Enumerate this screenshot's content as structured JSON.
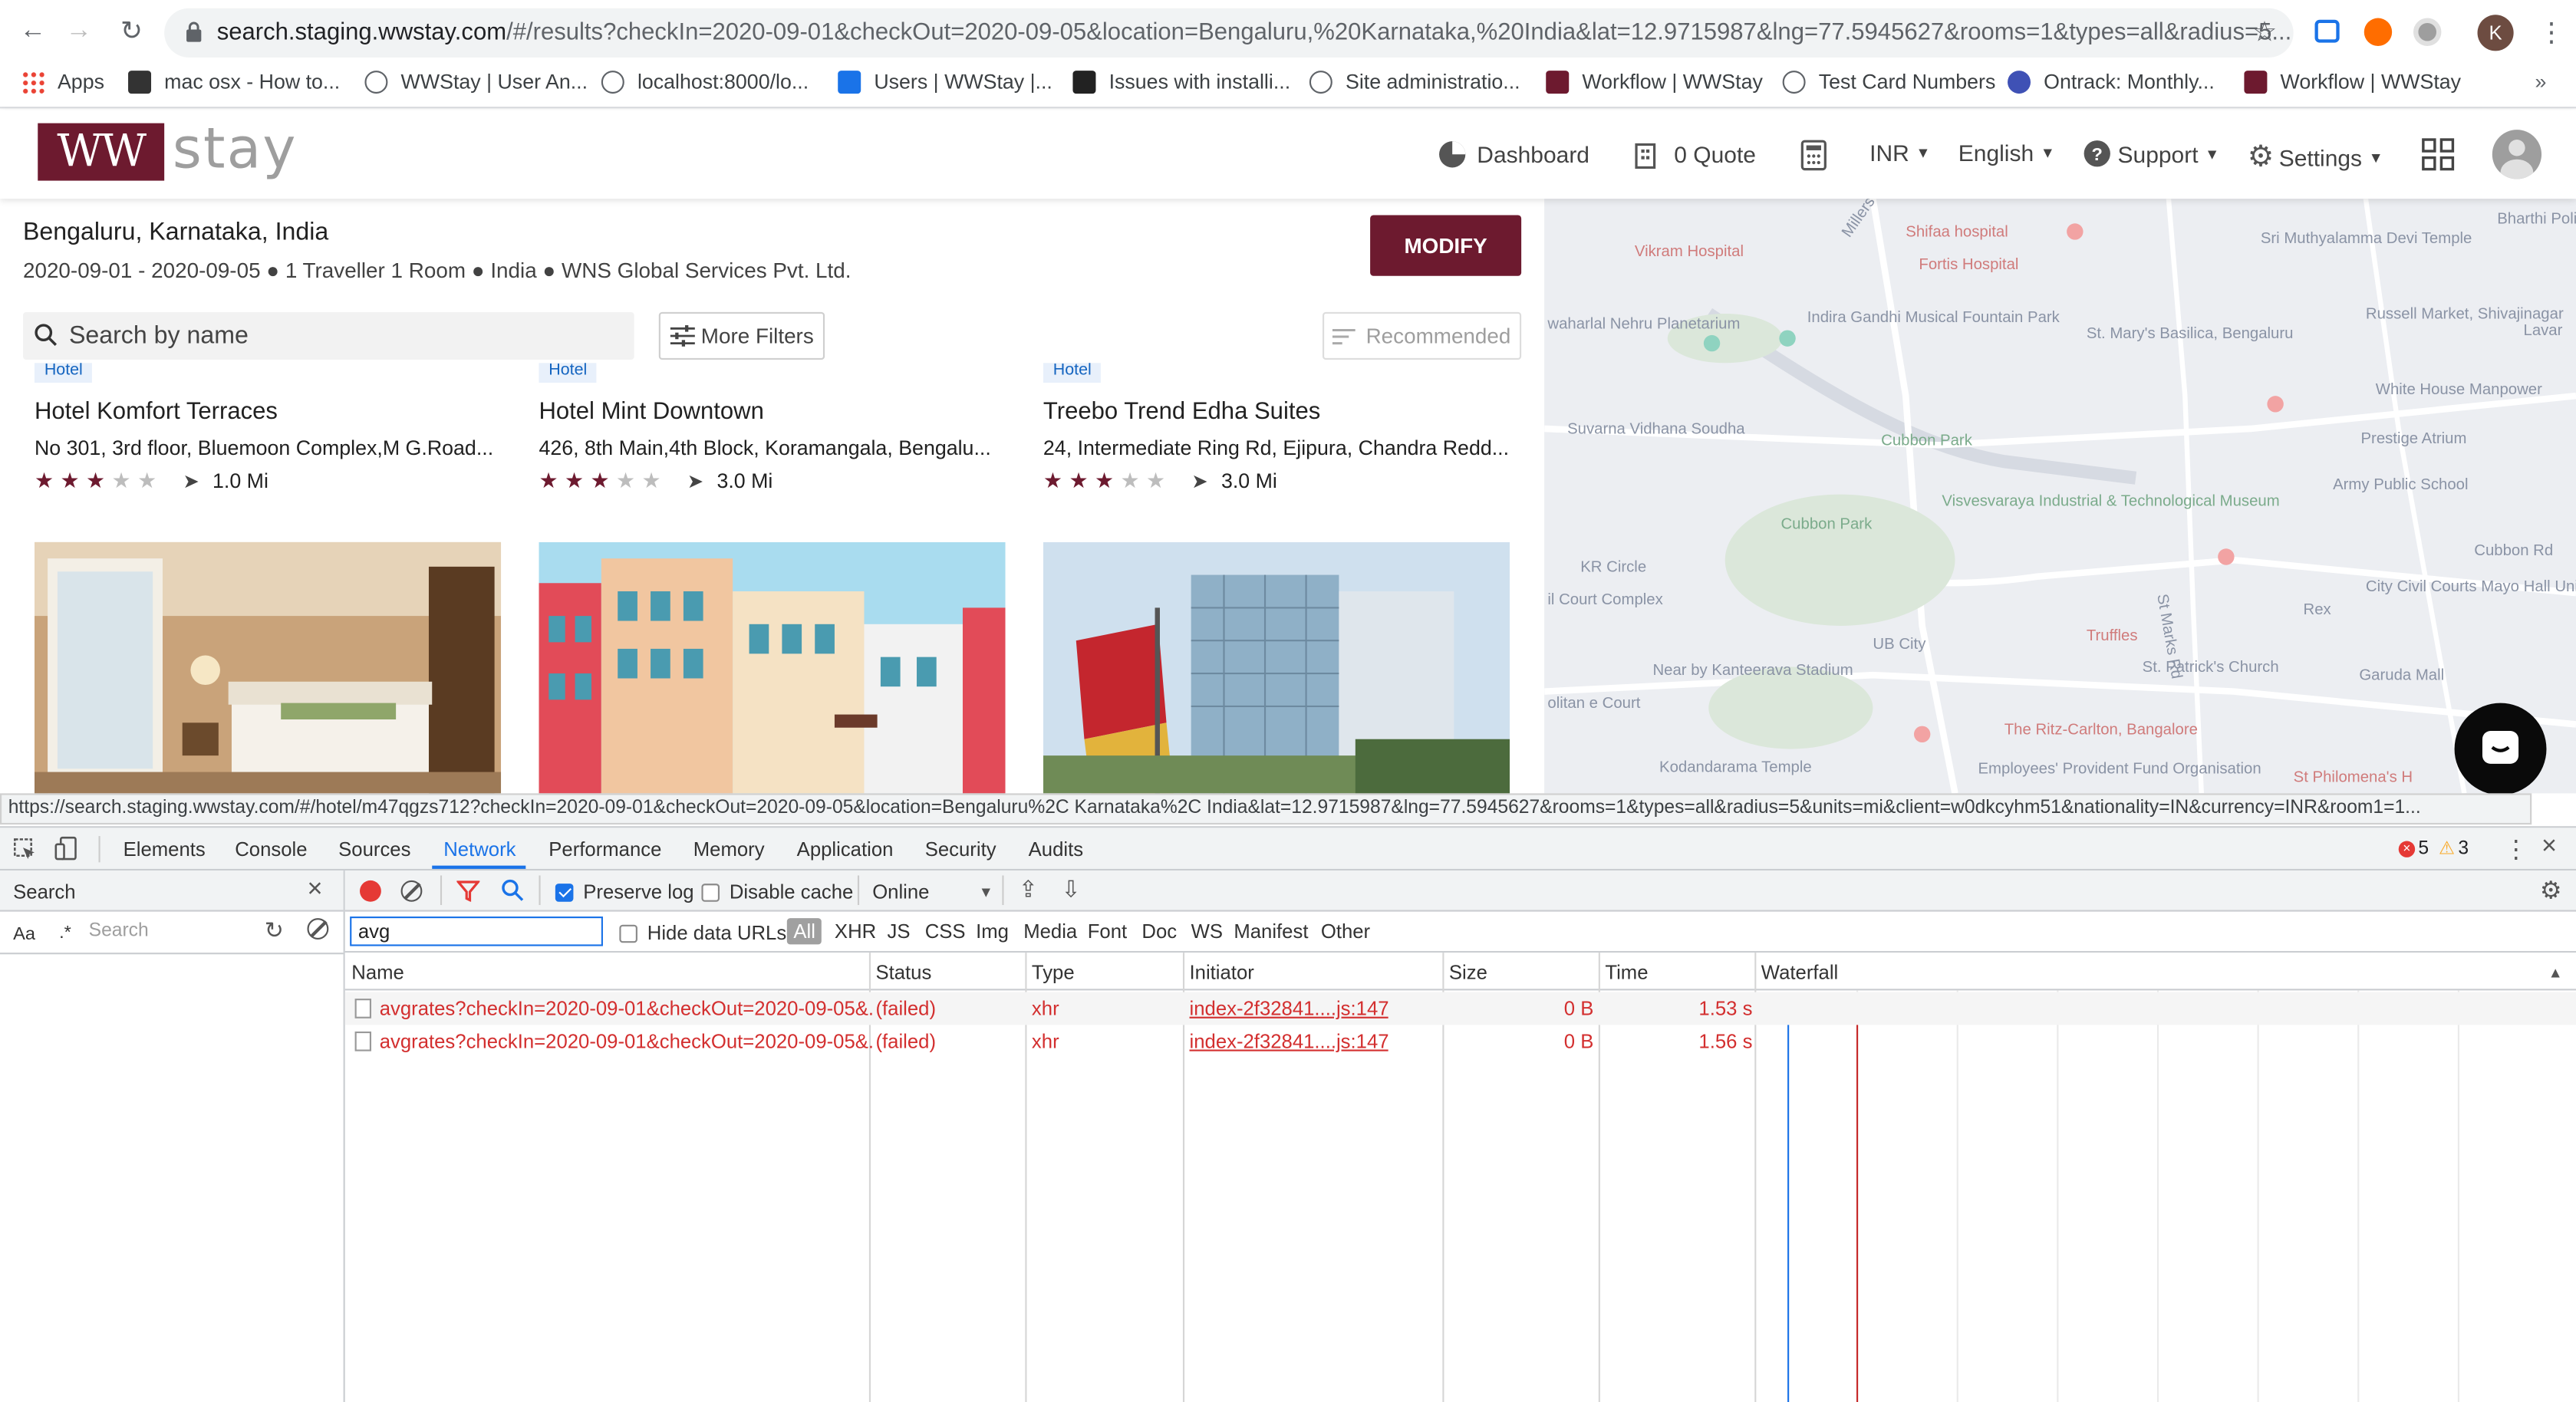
{
  "browser": {
    "url_host": "search.staging.wwstay.com",
    "url_rest": "/#/results?checkIn=2020-09-01&checkOut=2020-09-05&location=Bengaluru,%20Karnataka,%20India&lat=12.9715987&lng=77.5945627&rooms=1&types=all&radius=5...",
    "profile_initial": "K"
  },
  "bookmarks": [
    {
      "label": "Apps",
      "color": "#4285f4"
    },
    {
      "label": "mac osx - How to...",
      "color": "#333333"
    },
    {
      "label": "WWStay | User An...",
      "color": "#5f6368"
    },
    {
      "label": "localhost:8000/lo...",
      "color": "#5f6368"
    },
    {
      "label": "Users | WWStay |...",
      "color": "#1a73e8"
    },
    {
      "label": "Issues with installi...",
      "color": "#222222"
    },
    {
      "label": "Site administratio...",
      "color": "#5f6368"
    },
    {
      "label": "Workflow | WWStay",
      "color": "#6d1a2f"
    },
    {
      "label": "Test Card Numbers",
      "color": "#5f6368"
    },
    {
      "label": "Ontrack: Monthly...",
      "color": "#3f51b5"
    },
    {
      "label": "Workflow | WWStay",
      "color": "#6d1a2f"
    }
  ],
  "header": {
    "logo_ww": "WW",
    "logo_stay": "stay",
    "nav": {
      "dashboard": "Dashboard",
      "quote": "0 Quote",
      "currency": "INR",
      "language": "English",
      "support": "Support",
      "settings": "Settings"
    }
  },
  "search": {
    "location": "Bengaluru, Karnataka, India",
    "summary": "2020-09-01 - 2020-09-05 ● 1 Traveller 1 Room ● India ● WNS Global Services Pvt. Ltd.",
    "modify_label": "MODIFY",
    "placeholder": "Search by name",
    "filters_label": "More Filters",
    "sort_label": "Recommended"
  },
  "hotels": [
    {
      "tag": "Hotel",
      "name": "Hotel Komfort Terraces",
      "address": "No 301, 3rd floor, Bluemoon Complex,M G.Road...",
      "rating": 3,
      "distance": "1.0 Mi"
    },
    {
      "tag": "Hotel",
      "name": "Hotel Mint Downtown",
      "address": "426, 8th Main,4th Block, Koramangala, Bengalu...",
      "rating": 3,
      "distance": "3.0 Mi"
    },
    {
      "tag": "Hotel",
      "name": "Treebo Trend Edha Suites",
      "address": "24, Intermediate Ring Rd, Ejipura, Chandra Redd...",
      "rating": 3,
      "distance": "3.0 Mi"
    }
  ],
  "map_labels": [
    "Shifaa hospital",
    "Vikram Hospital",
    "Fortis Hospital",
    "Sri Muthyalamma Devi Temple",
    "Bharthi Police St",
    "Indira Gandhi Musical Fountain Park",
    "waharlal Nehru Planetarium",
    "St. Mary's Basilica, Bengaluru",
    "Russell Market, Shivajinagar",
    "Lavar",
    "White House Manpower",
    "Suvarna Vidhana Soudha",
    "Cubbon Park",
    "Prestige Atrium",
    "Army Public School",
    "Visvesvaraya Industrial & Technological Museum",
    "Cubbon Park",
    "Cubbon Rd",
    "KR Circle",
    "il Court Complex",
    "City Civil Courts Mayo Hall Unit",
    "Rex",
    "UB City",
    "Truffles",
    "St. Patrick's Church",
    "Near by Kanteerava Stadium",
    "Garuda Mall",
    "olitan e Court",
    "The Ritz-Carlton, Bangalore",
    "Kodandarama Temple",
    "Employees' Provident Fund Organisation",
    "St Philomena's H",
    "Millers Rd",
    "St Marks Rd"
  ],
  "status_bar": "https://search.staging.wwstay.com/#/hotel/m47qgzs712?checkIn=2020-09-01&checkOut=2020-09-05&location=Bengaluru%2C Karnataka%2C India&lat=12.9715987&lng=77.5945627&rooms=1&types=all&radius=5&units=mi&client=w0dkcyhm51&nationality=IN&currency=INR&room1=1...",
  "devtools": {
    "tabs": [
      "Elements",
      "Console",
      "Sources",
      "Network",
      "Performance",
      "Memory",
      "Application",
      "Security",
      "Audits"
    ],
    "active_tab": "Network",
    "errors": "5",
    "warnings": "3",
    "left_search_label": "Search",
    "left_search_placeholder": "Search",
    "aa_label": "Aa",
    "regex_label": ".*",
    "preserve_log": "Preserve log",
    "disable_cache": "Disable cache",
    "throttle": "Online",
    "filter_value": "avg",
    "hide_data_urls": "Hide data URLs",
    "types": [
      "All",
      "XHR",
      "JS",
      "CSS",
      "Img",
      "Media",
      "Font",
      "Doc",
      "WS",
      "Manifest",
      "Other"
    ],
    "columns": [
      "Name",
      "Status",
      "Type",
      "Initiator",
      "Size",
      "Time",
      "Waterfall"
    ],
    "rows": [
      {
        "name": "avgrates?checkIn=2020-09-01&checkOut=2020-09-05&...",
        "status": "(failed)",
        "type": "xhr",
        "initiator": "index-2f32841....js:147",
        "size": "0 B",
        "time": "1.53 s"
      },
      {
        "name": "avgrates?checkIn=2020-09-01&checkOut=2020-09-05&...",
        "status": "(failed)",
        "type": "xhr",
        "initiator": "index-2f32841....js:147",
        "size": "0 B",
        "time": "1.56 s"
      }
    ]
  }
}
